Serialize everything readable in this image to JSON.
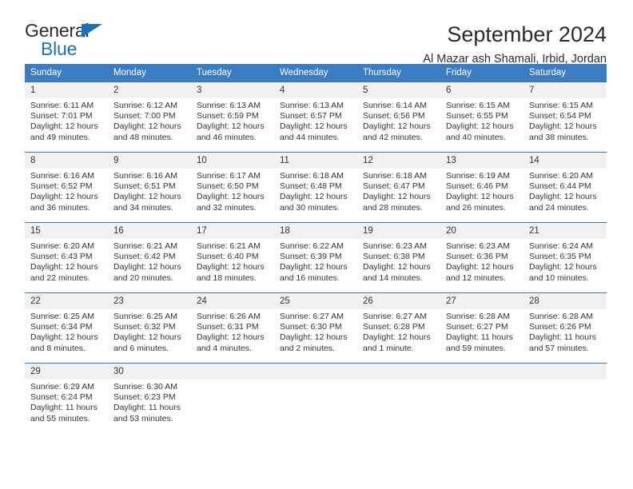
{
  "logo": {
    "word1": "General",
    "word2": "Blue",
    "triangle_color": "#1b72b8"
  },
  "header": {
    "title": "September 2024",
    "subtitle": "Al Mazar ash Shamali, Irbid, Jordan",
    "header_bg": "#3b7dc4",
    "daynum_bg": "#f1f1f1"
  },
  "weekday_headers": [
    "Sunday",
    "Monday",
    "Tuesday",
    "Wednesday",
    "Thursday",
    "Friday",
    "Saturday"
  ],
  "labels": {
    "sunrise_prefix": "Sunrise:",
    "sunset_prefix": "Sunset:",
    "daylight_prefix": "Daylight:"
  },
  "weeks": [
    [
      {
        "day": "1",
        "sunrise": "Sunrise: 6:11 AM",
        "sunset": "Sunset: 7:01 PM",
        "daylight_line1": "Daylight: 12 hours",
        "daylight_line2": "and 49 minutes."
      },
      {
        "day": "2",
        "sunrise": "Sunrise: 6:12 AM",
        "sunset": "Sunset: 7:00 PM",
        "daylight_line1": "Daylight: 12 hours",
        "daylight_line2": "and 48 minutes."
      },
      {
        "day": "3",
        "sunrise": "Sunrise: 6:13 AM",
        "sunset": "Sunset: 6:59 PM",
        "daylight_line1": "Daylight: 12 hours",
        "daylight_line2": "and 46 minutes."
      },
      {
        "day": "4",
        "sunrise": "Sunrise: 6:13 AM",
        "sunset": "Sunset: 6:57 PM",
        "daylight_line1": "Daylight: 12 hours",
        "daylight_line2": "and 44 minutes."
      },
      {
        "day": "5",
        "sunrise": "Sunrise: 6:14 AM",
        "sunset": "Sunset: 6:56 PM",
        "daylight_line1": "Daylight: 12 hours",
        "daylight_line2": "and 42 minutes."
      },
      {
        "day": "6",
        "sunrise": "Sunrise: 6:15 AM",
        "sunset": "Sunset: 6:55 PM",
        "daylight_line1": "Daylight: 12 hours",
        "daylight_line2": "and 40 minutes."
      },
      {
        "day": "7",
        "sunrise": "Sunrise: 6:15 AM",
        "sunset": "Sunset: 6:54 PM",
        "daylight_line1": "Daylight: 12 hours",
        "daylight_line2": "and 38 minutes."
      }
    ],
    [
      {
        "day": "8",
        "sunrise": "Sunrise: 6:16 AM",
        "sunset": "Sunset: 6:52 PM",
        "daylight_line1": "Daylight: 12 hours",
        "daylight_line2": "and 36 minutes."
      },
      {
        "day": "9",
        "sunrise": "Sunrise: 6:16 AM",
        "sunset": "Sunset: 6:51 PM",
        "daylight_line1": "Daylight: 12 hours",
        "daylight_line2": "and 34 minutes."
      },
      {
        "day": "10",
        "sunrise": "Sunrise: 6:17 AM",
        "sunset": "Sunset: 6:50 PM",
        "daylight_line1": "Daylight: 12 hours",
        "daylight_line2": "and 32 minutes."
      },
      {
        "day": "11",
        "sunrise": "Sunrise: 6:18 AM",
        "sunset": "Sunset: 6:48 PM",
        "daylight_line1": "Daylight: 12 hours",
        "daylight_line2": "and 30 minutes."
      },
      {
        "day": "12",
        "sunrise": "Sunrise: 6:18 AM",
        "sunset": "Sunset: 6:47 PM",
        "daylight_line1": "Daylight: 12 hours",
        "daylight_line2": "and 28 minutes."
      },
      {
        "day": "13",
        "sunrise": "Sunrise: 6:19 AM",
        "sunset": "Sunset: 6:46 PM",
        "daylight_line1": "Daylight: 12 hours",
        "daylight_line2": "and 26 minutes."
      },
      {
        "day": "14",
        "sunrise": "Sunrise: 6:20 AM",
        "sunset": "Sunset: 6:44 PM",
        "daylight_line1": "Daylight: 12 hours",
        "daylight_line2": "and 24 minutes."
      }
    ],
    [
      {
        "day": "15",
        "sunrise": "Sunrise: 6:20 AM",
        "sunset": "Sunset: 6:43 PM",
        "daylight_line1": "Daylight: 12 hours",
        "daylight_line2": "and 22 minutes."
      },
      {
        "day": "16",
        "sunrise": "Sunrise: 6:21 AM",
        "sunset": "Sunset: 6:42 PM",
        "daylight_line1": "Daylight: 12 hours",
        "daylight_line2": "and 20 minutes."
      },
      {
        "day": "17",
        "sunrise": "Sunrise: 6:21 AM",
        "sunset": "Sunset: 6:40 PM",
        "daylight_line1": "Daylight: 12 hours",
        "daylight_line2": "and 18 minutes."
      },
      {
        "day": "18",
        "sunrise": "Sunrise: 6:22 AM",
        "sunset": "Sunset: 6:39 PM",
        "daylight_line1": "Daylight: 12 hours",
        "daylight_line2": "and 16 minutes."
      },
      {
        "day": "19",
        "sunrise": "Sunrise: 6:23 AM",
        "sunset": "Sunset: 6:38 PM",
        "daylight_line1": "Daylight: 12 hours",
        "daylight_line2": "and 14 minutes."
      },
      {
        "day": "20",
        "sunrise": "Sunrise: 6:23 AM",
        "sunset": "Sunset: 6:36 PM",
        "daylight_line1": "Daylight: 12 hours",
        "daylight_line2": "and 12 minutes."
      },
      {
        "day": "21",
        "sunrise": "Sunrise: 6:24 AM",
        "sunset": "Sunset: 6:35 PM",
        "daylight_line1": "Daylight: 12 hours",
        "daylight_line2": "and 10 minutes."
      }
    ],
    [
      {
        "day": "22",
        "sunrise": "Sunrise: 6:25 AM",
        "sunset": "Sunset: 6:34 PM",
        "daylight_line1": "Daylight: 12 hours",
        "daylight_line2": "and 8 minutes."
      },
      {
        "day": "23",
        "sunrise": "Sunrise: 6:25 AM",
        "sunset": "Sunset: 6:32 PM",
        "daylight_line1": "Daylight: 12 hours",
        "daylight_line2": "and 6 minutes."
      },
      {
        "day": "24",
        "sunrise": "Sunrise: 6:26 AM",
        "sunset": "Sunset: 6:31 PM",
        "daylight_line1": "Daylight: 12 hours",
        "daylight_line2": "and 4 minutes."
      },
      {
        "day": "25",
        "sunrise": "Sunrise: 6:27 AM",
        "sunset": "Sunset: 6:30 PM",
        "daylight_line1": "Daylight: 12 hours",
        "daylight_line2": "and 2 minutes."
      },
      {
        "day": "26",
        "sunrise": "Sunrise: 6:27 AM",
        "sunset": "Sunset: 6:28 PM",
        "daylight_line1": "Daylight: 12 hours",
        "daylight_line2": "and 1 minute."
      },
      {
        "day": "27",
        "sunrise": "Sunrise: 6:28 AM",
        "sunset": "Sunset: 6:27 PM",
        "daylight_line1": "Daylight: 11 hours",
        "daylight_line2": "and 59 minutes."
      },
      {
        "day": "28",
        "sunrise": "Sunrise: 6:28 AM",
        "sunset": "Sunset: 6:26 PM",
        "daylight_line1": "Daylight: 11 hours",
        "daylight_line2": "and 57 minutes."
      }
    ],
    [
      {
        "day": "29",
        "sunrise": "Sunrise: 6:29 AM",
        "sunset": "Sunset: 6:24 PM",
        "daylight_line1": "Daylight: 11 hours",
        "daylight_line2": "and 55 minutes."
      },
      {
        "day": "30",
        "sunrise": "Sunrise: 6:30 AM",
        "sunset": "Sunset: 6:23 PM",
        "daylight_line1": "Daylight: 11 hours",
        "daylight_line2": "and 53 minutes."
      },
      {
        "day": "",
        "sunrise": "",
        "sunset": "",
        "daylight_line1": "",
        "daylight_line2": ""
      },
      {
        "day": "",
        "sunrise": "",
        "sunset": "",
        "daylight_line1": "",
        "daylight_line2": ""
      },
      {
        "day": "",
        "sunrise": "",
        "sunset": "",
        "daylight_line1": "",
        "daylight_line2": ""
      },
      {
        "day": "",
        "sunrise": "",
        "sunset": "",
        "daylight_line1": "",
        "daylight_line2": ""
      },
      {
        "day": "",
        "sunrise": "",
        "sunset": "",
        "daylight_line1": "",
        "daylight_line2": ""
      }
    ]
  ]
}
